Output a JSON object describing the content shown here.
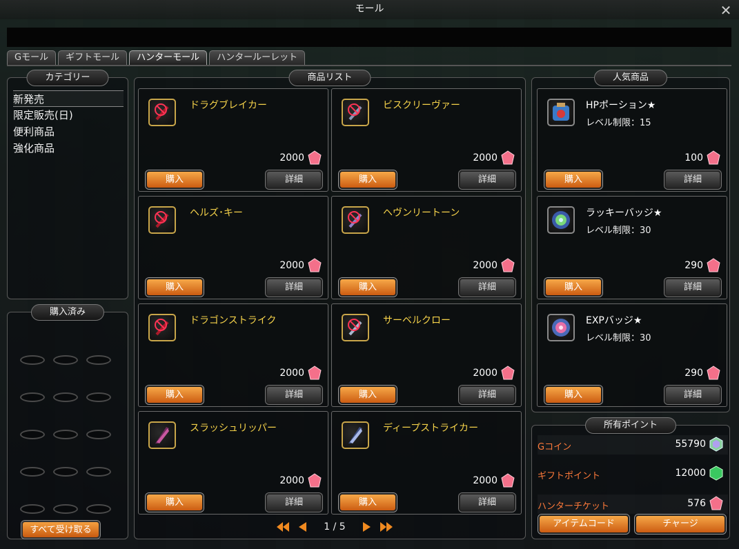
{
  "window": {
    "title": "モール"
  },
  "tabs": [
    {
      "label": "Gモール"
    },
    {
      "label": "ギフトモール"
    },
    {
      "label": "ハンターモール"
    },
    {
      "label": "ハンタールーレット"
    }
  ],
  "category": {
    "title": "カテゴリー",
    "items": [
      {
        "label": "新発売"
      },
      {
        "label": "限定販売(日)"
      },
      {
        "label": "便利商品"
      },
      {
        "label": "強化商品"
      }
    ]
  },
  "purchased": {
    "title": "購入済み",
    "receive_all": "すべて受け取る"
  },
  "products": {
    "title": "商品リスト",
    "buy_label": "購入",
    "detail_label": "詳細",
    "items": [
      {
        "name": "ドラグブレイカー",
        "price": "2000",
        "icon": "forbidden-weapon-icon"
      },
      {
        "name": "ビスクリーヴァー",
        "price": "2000",
        "icon": "forbidden-weapon-icon"
      },
      {
        "name": "ヘルズ･キー",
        "price": "2000",
        "icon": "forbidden-weapon-icon"
      },
      {
        "name": "ヘヴンリートーン",
        "price": "2000",
        "icon": "forbidden-weapon-icon"
      },
      {
        "name": "ドラゴンストライク",
        "price": "2000",
        "icon": "forbidden-weapon-icon"
      },
      {
        "name": "サーベルクロー",
        "price": "2000",
        "icon": "forbidden-weapon-icon"
      },
      {
        "name": "スラッシュリッパー",
        "price": "2000",
        "icon": "blade-weapon-icon"
      },
      {
        "name": "ディープストライカー",
        "price": "2000",
        "icon": "blade-weapon-icon"
      }
    ],
    "pager": {
      "text": "1 / 5"
    }
  },
  "popular": {
    "title": "人気商品",
    "items": [
      {
        "name": "HPポーション★",
        "sub": "レベル制限：15",
        "price": "100",
        "icon": "hp-potion-icon"
      },
      {
        "name": "ラッキーバッジ★",
        "sub": "レベル制限：30",
        "price": "290",
        "icon": "lucky-badge-icon"
      },
      {
        "name": "EXPバッジ★",
        "sub": "レベル制限：30",
        "price": "290",
        "icon": "exp-badge-icon"
      }
    ]
  },
  "points": {
    "title": "所有ポイント",
    "rows": [
      {
        "label": "Gコイン",
        "value": "55790",
        "gem": "rainbow-gem-icon"
      },
      {
        "label": "ギフトポイント",
        "value": "12000",
        "gem": "green-gem-icon"
      },
      {
        "label": "ハンターチケット",
        "value": "576",
        "gem": "pink-gem-icon"
      }
    ],
    "item_code": "アイテムコード",
    "charge": "チャージ"
  },
  "colors": {
    "accent_orange": "#cc5c12",
    "name_gold": "#f5d24a",
    "point_label": "#ff7a3a"
  }
}
